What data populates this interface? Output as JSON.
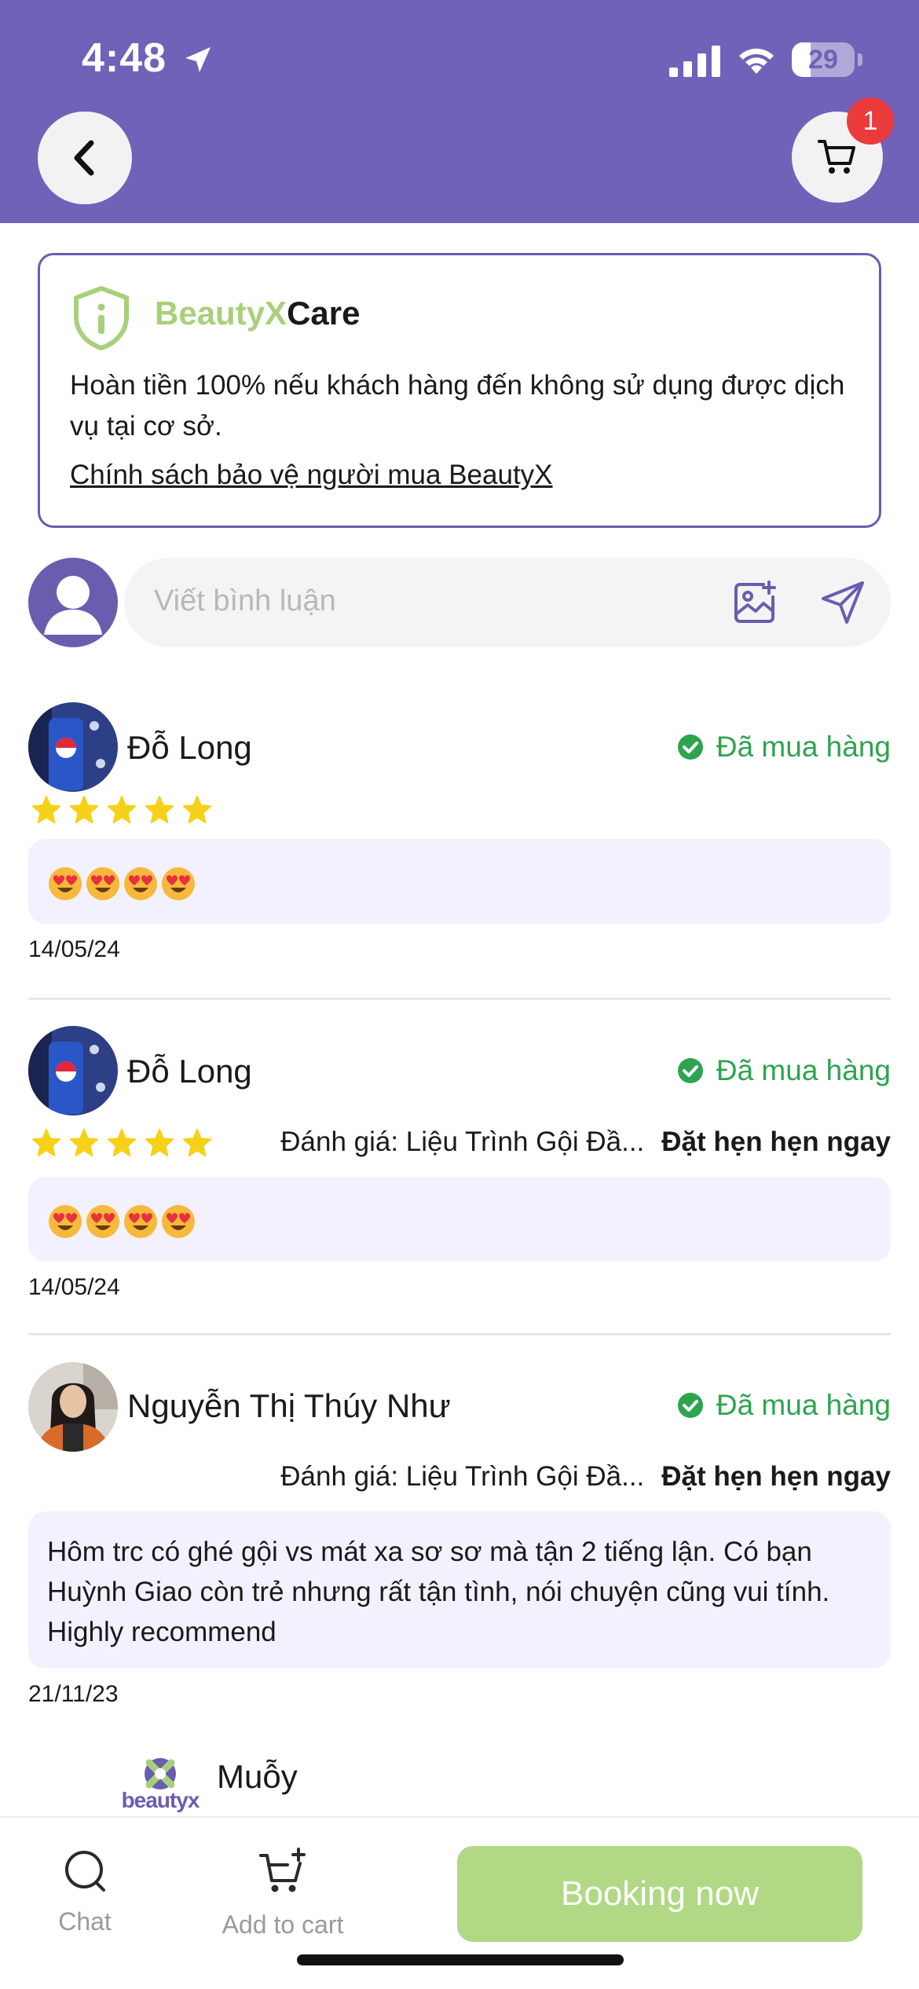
{
  "status_bar": {
    "time": "4:48",
    "battery": "29"
  },
  "header": {
    "cart_count": "1"
  },
  "care": {
    "brand": "BeautyX",
    "care": "Care",
    "description": "Hoàn tiền 100% nếu khách hàng đến không sử dụng được dịch vụ tại cơ sở.",
    "policy_link": "Chính sách bảo vệ người mua BeautyX"
  },
  "comment_input": {
    "placeholder": "Viết bình luận"
  },
  "reviews": [
    {
      "name": "Đỗ Long",
      "badge": "Đã mua hàng",
      "rating": 5,
      "text": "😍😍😍😍",
      "date": "14/05/24"
    },
    {
      "name": "Đỗ Long",
      "badge": "Đã mua hàng",
      "rating": 5,
      "eval_label": "Đánh giá: Liệu Trình Gội Đầ...",
      "book_label": "Đặt hẹn hẹn ngay",
      "text": "😍😍😍😍",
      "date": "14/05/24"
    },
    {
      "name": "Nguyễn Thị Thúy Như",
      "badge": "Đã mua hàng",
      "eval_label": "Đánh giá: Liệu Trình Gội Đầ...",
      "book_label": "Đặt hẹn hẹn ngay",
      "text": "Hôm trc có ghé gội vs mát xa sơ sơ mà tận 2 tiếng lận. Có bạn Huỳnh Giao còn trẻ nhưng rất tận tình, nói chuyện cũng vui tính. Highly recommend",
      "date": "21/11/23"
    },
    {
      "name": "Muỗy",
      "logo_text": "beautyx"
    }
  ],
  "bottom_bar": {
    "chat_label": "Chat",
    "add_to_cart_label": "Add to cart",
    "booking_label": "Booking now"
  },
  "colors": {
    "header": "#7261b8",
    "brand_green": "#a8d07a",
    "bought_green": "#2ea44f",
    "bubble": "#f3f1fd",
    "booking_button": "#b1d884",
    "cart_badge": "#ec3b3b"
  }
}
